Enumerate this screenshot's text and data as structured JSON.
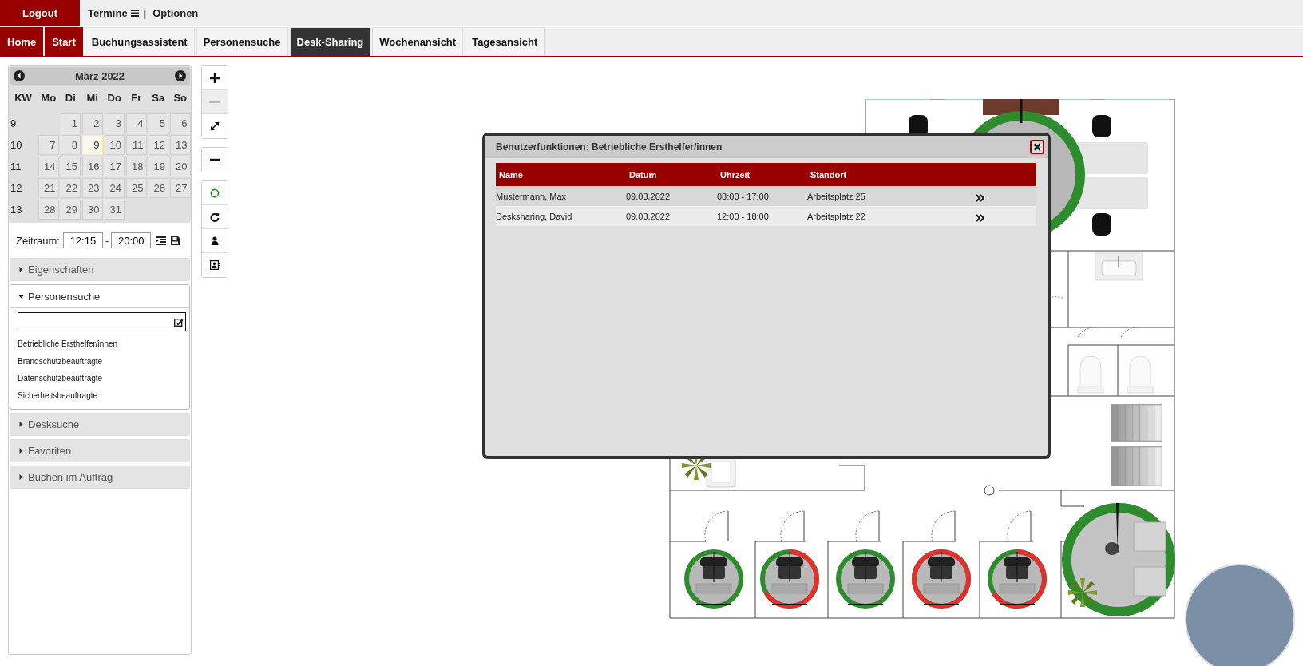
{
  "top_bar": {
    "logout": "Logout",
    "menu": [
      {
        "label": "Termine",
        "kind": "menu"
      },
      {
        "label": "|",
        "kind": "separator"
      },
      {
        "label": "Optionen",
        "kind": "link"
      }
    ]
  },
  "tabs": [
    {
      "label": "Home",
      "kind": "primary",
      "selected": false
    },
    {
      "label": "Start",
      "kind": "primary",
      "selected": false
    },
    {
      "label": "Buchungsassistent",
      "kind": "tab",
      "selected": false
    },
    {
      "label": "Personensuche",
      "kind": "tab",
      "selected": false
    },
    {
      "label": "Desk-Sharing",
      "kind": "tab",
      "selected": true
    },
    {
      "label": "Wochenansicht",
      "kind": "tab",
      "selected": false
    },
    {
      "label": "Tagesansicht",
      "kind": "tab",
      "selected": false
    }
  ],
  "calendar": {
    "title": "März 2022",
    "weekdays": [
      "KW",
      "Mo",
      "Di",
      "Mi",
      "Do",
      "Fr",
      "Sa",
      "So"
    ],
    "weeks": [
      {
        "kw": "9",
        "days": [
          {
            "label": "1",
            "selected": false
          },
          {
            "label": "2",
            "selected": false
          },
          {
            "label": "3",
            "selected": false
          },
          {
            "label": "4",
            "selected": false
          },
          {
            "label": "5",
            "selected": false
          },
          {
            "label": "6",
            "selected": false
          }
        ]
      },
      {
        "kw": "10",
        "days": [
          {
            "label": "7",
            "selected": false
          },
          {
            "label": "8",
            "selected": false
          },
          {
            "label": "9",
            "selected": true
          },
          {
            "label": "10",
            "selected": false
          },
          {
            "label": "11",
            "selected": false
          },
          {
            "label": "12",
            "selected": false
          },
          {
            "label": "13",
            "selected": false
          }
        ]
      },
      {
        "kw": "11",
        "days": [
          {
            "label": "14",
            "selected": false
          },
          {
            "label": "15",
            "selected": false
          },
          {
            "label": "16",
            "selected": false
          },
          {
            "label": "17",
            "selected": false
          },
          {
            "label": "18",
            "selected": false
          },
          {
            "label": "19",
            "selected": false
          },
          {
            "label": "20",
            "selected": false
          }
        ]
      },
      {
        "kw": "12",
        "days": [
          {
            "label": "21",
            "selected": false
          },
          {
            "label": "22",
            "selected": false
          },
          {
            "label": "23",
            "selected": false
          },
          {
            "label": "24",
            "selected": false
          },
          {
            "label": "25",
            "selected": false
          },
          {
            "label": "26",
            "selected": false
          },
          {
            "label": "27",
            "selected": false
          }
        ]
      },
      {
        "kw": "13",
        "days": [
          {
            "label": "28",
            "selected": false
          },
          {
            "label": "29",
            "selected": false
          },
          {
            "label": "30",
            "selected": false
          },
          {
            "label": "31",
            "selected": false
          }
        ]
      }
    ]
  },
  "time_range": {
    "label": "Zeitraum:",
    "from": "12:15",
    "separator": "-",
    "to": "20:00"
  },
  "sections": [
    {
      "label": "Eigenschaften",
      "expanded": false
    },
    {
      "label": "Personensuche",
      "expanded": true,
      "items": [
        "Betriebliche Ersthelfer/innen",
        "Brandschutzbeauftragte",
        "Datenschutzbeauftragte",
        "Sicherheitsbeauftragte"
      ]
    },
    {
      "label": "Desksuche",
      "expanded": false
    },
    {
      "label": "Favoriten",
      "expanded": false
    },
    {
      "label": "Buchen im Auftrag",
      "expanded": false
    }
  ],
  "toolbar": [
    [
      {
        "kind": "zoom-in",
        "disabled": false
      },
      {
        "kind": "zoom-out",
        "disabled": true
      },
      {
        "kind": "fit",
        "disabled": false
      }
    ],
    [
      {
        "kind": "minus",
        "disabled": false
      }
    ],
    [
      {
        "kind": "circle",
        "disabled": false
      },
      {
        "kind": "refresh",
        "disabled": false
      },
      {
        "kind": "person",
        "disabled": false
      },
      {
        "kind": "contact",
        "disabled": false
      }
    ]
  ],
  "dialog": {
    "title": "Benutzerfunktionen: Betriebliche Ersthelfer/innen",
    "columns": [
      "Name",
      "Datum",
      "Uhrzeit",
      "Standort"
    ],
    "rows": [
      [
        "Mustermann, Max",
        "09.03.2022",
        "08:00 - 17:00",
        "Arbeitsplatz 25"
      ],
      [
        "Desksharing, David",
        "09.03.2022",
        "12:00 - 18:00",
        "Arbeitsplatz 22"
      ]
    ]
  },
  "desks": [
    {
      "kind": "free"
    },
    {
      "kind": "partial"
    },
    {
      "kind": "free"
    },
    {
      "kind": "booked"
    },
    {
      "kind": "partial"
    }
  ]
}
